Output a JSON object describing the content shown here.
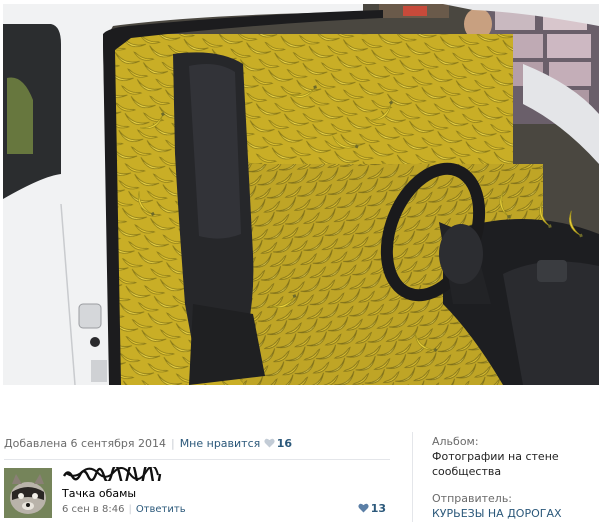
{
  "post": {
    "added_label": "Добавлена 6 сентября 2014",
    "like_label": "Мне нравится",
    "like_count": "16"
  },
  "comment": {
    "text": "Тачка обамы",
    "time": "6 сен в 8:46",
    "reply_label": "Ответить",
    "like_count": "13"
  },
  "sidebar": {
    "album_label": "Альбом:",
    "album_value": "Фотографии на стене сообщества",
    "sender_label": "Отправитель:",
    "sender_value": "КУРЬЕЗЫ НА ДОРОГАХ"
  },
  "colors": {
    "link": "#2b587a",
    "muted": "#6b6b6b",
    "banana": "#e9cf3a",
    "car_body": "#f2f3f4"
  }
}
